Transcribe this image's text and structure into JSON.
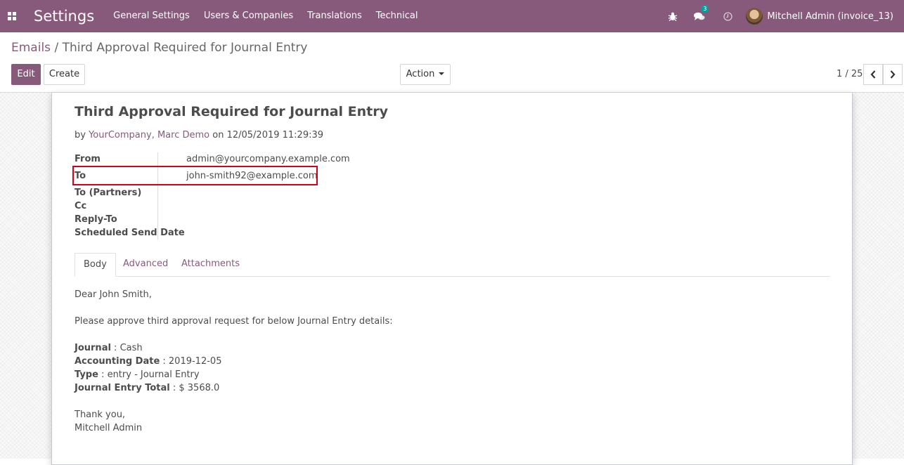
{
  "navbar": {
    "brand": "Settings",
    "menu": [
      "General Settings",
      "Users & Companies",
      "Translations",
      "Technical"
    ],
    "chat_count": "3",
    "user": "Mitchell Admin (invoice_13)"
  },
  "breadcrumb": {
    "parent": "Emails",
    "separator": "/",
    "current": "Third Approval Required for Journal Entry"
  },
  "buttons": {
    "edit": "Edit",
    "create": "Create",
    "action": "Action"
  },
  "pager": {
    "value": "1 / 25"
  },
  "record": {
    "title": "Third Approval Required for Journal Entry",
    "by_prefix": "by",
    "authors": "YourCompany, Marc Demo",
    "on_text": "on 12/05/2019 11:29:39",
    "fields": [
      {
        "label": "From",
        "value": "admin@yourcompany.example.com"
      },
      {
        "label": "To",
        "value": "john-smith92@example.com"
      },
      {
        "label": "To (Partners)",
        "value": ""
      },
      {
        "label": "Cc",
        "value": ""
      },
      {
        "label": "Reply-To",
        "value": ""
      },
      {
        "label": "Scheduled Send Date",
        "value": ""
      }
    ],
    "tabs": [
      "Body",
      "Advanced",
      "Attachments"
    ],
    "body": {
      "greeting": "Dear John Smith,",
      "intro": "Please approve third approval request for below Journal Entry details:",
      "details": [
        {
          "label": "Journal",
          "value": " : Cash"
        },
        {
          "label": "Accounting Date",
          "value": " : 2019-12-05"
        },
        {
          "label": "Type",
          "value": " : entry - Journal Entry"
        },
        {
          "label": "Journal Entry Total",
          "value": " : $ 3568.0"
        }
      ],
      "closing": "Thank you,",
      "signature": "Mitchell Admin"
    }
  }
}
